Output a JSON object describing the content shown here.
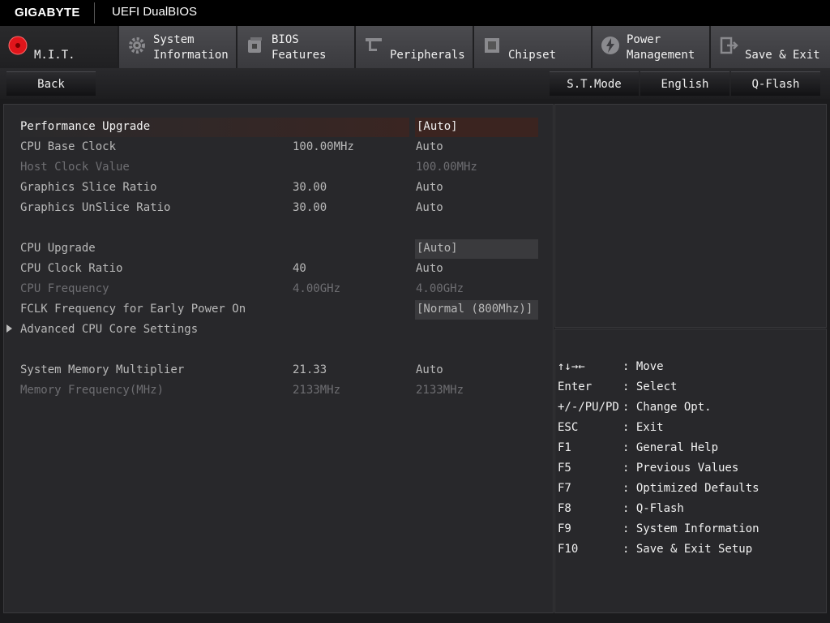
{
  "header": {
    "brand": "GIGABYTE",
    "title": "UEFI DualBIOS"
  },
  "tabs": [
    {
      "line1": "",
      "line2": "M.I.T.",
      "icon": "mit-icon"
    },
    {
      "line1": "System",
      "line2": "Information",
      "icon": "gear-icon"
    },
    {
      "line1": "BIOS",
      "line2": "Features",
      "icon": "bios-features-icon"
    },
    {
      "line1": "",
      "line2": "Peripherals",
      "icon": "peripherals-icon"
    },
    {
      "line1": "",
      "line2": "Chipset",
      "icon": "chipset-icon"
    },
    {
      "line1": "Power",
      "line2": "Management",
      "icon": "power-icon"
    },
    {
      "line1": "",
      "line2": "Save & Exit",
      "icon": "exit-icon"
    }
  ],
  "toolbar": {
    "back": "Back",
    "st_mode": "S.T.Mode",
    "language": "English",
    "qflash": "Q-Flash"
  },
  "settings": [
    {
      "name": "Performance Upgrade",
      "current": "",
      "value": "[Auto]",
      "state": "selected",
      "boxed": true
    },
    {
      "name": "CPU Base Clock",
      "current": "100.00MHz",
      "value": "Auto",
      "state": "normal",
      "boxed": false
    },
    {
      "name": "Host Clock Value",
      "current": "",
      "value": "100.00MHz",
      "state": "disabled",
      "boxed": false
    },
    {
      "name": "Graphics Slice Ratio",
      "current": "30.00",
      "value": "Auto",
      "state": "normal",
      "boxed": false
    },
    {
      "name": "Graphics UnSlice Ratio",
      "current": "30.00",
      "value": "Auto",
      "state": "normal",
      "boxed": false
    },
    {
      "name": "CPU Upgrade",
      "current": "",
      "value": "[Auto]",
      "state": "normal",
      "boxed": true
    },
    {
      "name": "CPU Clock Ratio",
      "current": "40",
      "value": "Auto",
      "state": "normal",
      "boxed": false
    },
    {
      "name": "CPU Frequency",
      "current": "4.00GHz",
      "value": "4.00GHz",
      "state": "disabled",
      "boxed": false
    },
    {
      "name": "FCLK Frequency for Early Power On",
      "current": "",
      "value": "[Normal (800Mhz)]",
      "state": "normal",
      "boxed": true
    },
    {
      "name": "Advanced CPU Core Settings",
      "current": "",
      "value": "",
      "state": "submenu",
      "boxed": false
    },
    {
      "name": "System Memory Multiplier",
      "current": "21.33",
      "value": "Auto",
      "state": "normal",
      "boxed": false
    },
    {
      "name": "Memory Frequency(MHz)",
      "current": "2133MHz",
      "value": "2133MHz",
      "state": "disabled",
      "boxed": false
    }
  ],
  "help": [
    {
      "key": "↑↓→←",
      "desc": ": Move"
    },
    {
      "key": "Enter",
      "desc": ": Select"
    },
    {
      "key": "+/-/PU/PD",
      "desc": ": Change Opt."
    },
    {
      "key": "ESC",
      "desc": ": Exit"
    },
    {
      "key": "F1",
      "desc": ": General Help"
    },
    {
      "key": "F5",
      "desc": ": Previous Values"
    },
    {
      "key": "F7",
      "desc": ": Optimized Defaults"
    },
    {
      "key": "F8",
      "desc": ": Q-Flash"
    },
    {
      "key": "F9",
      "desc": ": System Information"
    },
    {
      "key": "F10",
      "desc": ": Save & Exit Setup"
    }
  ]
}
